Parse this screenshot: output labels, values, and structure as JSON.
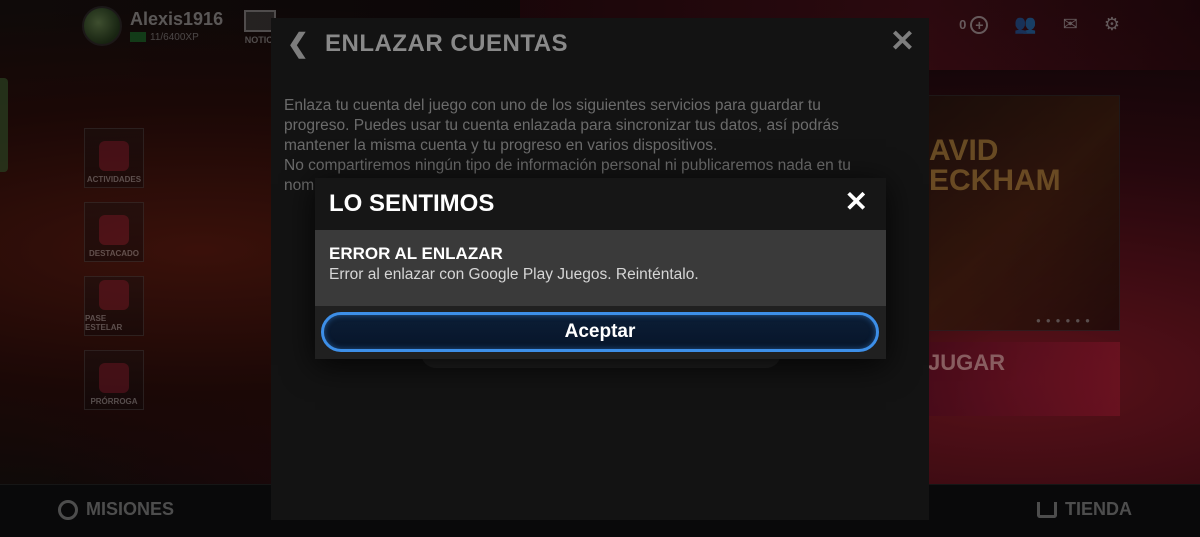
{
  "background": {
    "profile": {
      "name": "Alexis1916",
      "xp": "11/6400XP"
    },
    "news_label": "NOTICI",
    "coins": "0",
    "side_menu": [
      {
        "label": "ACTIVIDADES"
      },
      {
        "label": "DESTACADO"
      },
      {
        "label": "PASE ESTELAR"
      },
      {
        "label": "PRÓRROGA"
      }
    ],
    "promo_text": "AVID\nECKHAM",
    "play_text": "JUGAR",
    "bottom_bar": {
      "missions": "MISIONES",
      "store": "TIENDA"
    }
  },
  "panel": {
    "title": "ENLAZAR CUENTAS",
    "description_lines": [
      "Enlaza tu cuenta del juego con uno de los siguientes servicios para guardar tu",
      "progreso. Puedes usar tu cuenta enlazada para sincronizar tus datos, así podrás",
      "mantener la misma cuenta y tu progreso en varios dispositivos.",
      "No compartiremos ningún tipo de información personal ni publicaremos nada en tu",
      "nom"
    ]
  },
  "dialog": {
    "title": "LO SENTIMOS",
    "error_title": "ERROR AL ENLAZAR",
    "error_message": "Error al enlazar con Google Play Juegos. Reinténtalo.",
    "accept_label": "Aceptar"
  },
  "colors": {
    "accent_blue": "#3d8fe8",
    "dialog_bg": "#1b1b1b",
    "dialog_body_bg": "#3a3a3a"
  }
}
